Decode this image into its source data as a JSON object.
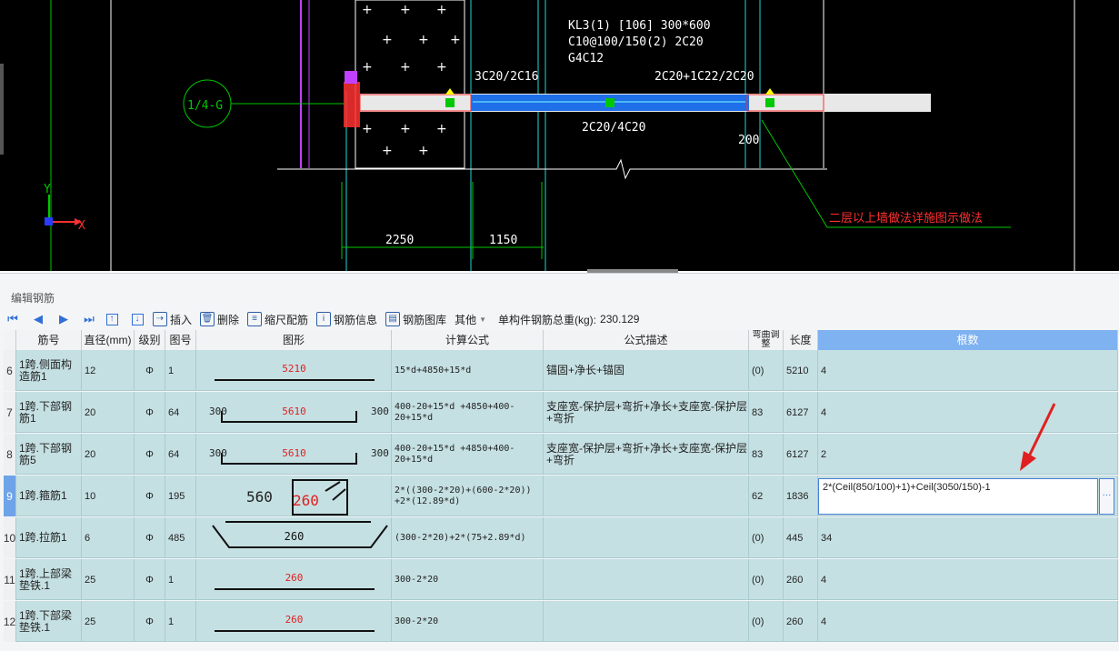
{
  "cad": {
    "beam_label": "KL3(1) [106] 300*600",
    "stirrup_label": "C10@100/150(2) 2C20",
    "side_bar_label": "G4C12",
    "left_top_bar": "3C20/2C16",
    "right_top_bar": "2C20+1C22/2C20",
    "bottom_bar": "2C20/4C20",
    "dim_2250": "2250",
    "dim_1150": "1150",
    "dim_200": "200",
    "axis_label": "1/4-G",
    "axis_y": "Y",
    "axis_x": "X",
    "note": "二层以上墙做法详施图示做法",
    "colors": {
      "beam": "#1e6fe8",
      "green": "#00c800",
      "magenta": "#c040ff",
      "red": "#ff3030",
      "cyan": "#1fd6d6"
    }
  },
  "panel": {
    "title": "编辑钢筋",
    "toolbar": {
      "nav_first": "first-icon",
      "nav_prev": "prev-icon",
      "nav_next": "next-icon",
      "nav_last": "last-icon",
      "move_up": "move-up-icon",
      "move_down": "move-down-icon",
      "insert": "插入",
      "delete": "删除",
      "scale": "缩尺配筋",
      "info": "钢筋信息",
      "library": "钢筋图库",
      "other": "其他",
      "weight_label": "单构件钢筋总重(kg):",
      "weight_value": "230.129"
    },
    "columns": [
      "筋号",
      "直径(mm)",
      "级别",
      "图号",
      "图形",
      "计算公式",
      "公式描述",
      "弯曲调整",
      "长度",
      "根数"
    ],
    "rows": [
      {
        "idx": "6",
        "name": "1跨.侧面构造筋1",
        "dia": "12",
        "grade": "Φ",
        "fig": "1",
        "shape": {
          "type": "straight",
          "mid": "5210"
        },
        "formula": "15*d+4850+15*d",
        "desc": "锚固+净长+锚固",
        "bend": "(0)",
        "len": "5210",
        "count": "4"
      },
      {
        "idx": "7",
        "name": "1跨.下部钢筋1",
        "dia": "20",
        "grade": "Φ",
        "fig": "64",
        "shape": {
          "type": "u",
          "left": "300",
          "mid": "5610",
          "right": "300"
        },
        "formula": "400-20+15*d +4850+400-20+15*d",
        "desc": "支座宽-保护层+弯折+净长+支座宽-保护层+弯折",
        "bend": "83",
        "len": "6127",
        "count": "4"
      },
      {
        "idx": "8",
        "name": "1跨.下部钢筋5",
        "dia": "20",
        "grade": "Φ",
        "fig": "64",
        "shape": {
          "type": "u",
          "left": "300",
          "mid": "5610",
          "right": "300"
        },
        "formula": "400-20+15*d +4850+400-20+15*d",
        "desc": "支座宽-保护层+弯折+净长+支座宽-保护层+弯折",
        "bend": "83",
        "len": "6127",
        "count": "2"
      },
      {
        "idx": "9",
        "name": "1跨.箍筋1",
        "dia": "10",
        "grade": "Φ",
        "fig": "195",
        "shape": {
          "type": "stirrup",
          "left": "560",
          "mid": "260"
        },
        "formula": "2*((300-2*20)+(600-2*20)) +2*(12.89*d)",
        "desc": "",
        "bend": "62",
        "len": "1836",
        "count": "2*(Ceil(850/100)+1)+Ceil(3050/150)-1",
        "editing": true
      },
      {
        "idx": "10",
        "name": "1跨.拉筋1",
        "dia": "6",
        "grade": "Φ",
        "fig": "485",
        "shape": {
          "type": "tie",
          "mid": "260"
        },
        "formula": "(300-2*20)+2*(75+2.89*d)",
        "desc": "",
        "bend": "(0)",
        "len": "445",
        "count": "34"
      },
      {
        "idx": "11",
        "name": "1跨.上部梁垫铁.1",
        "dia": "25",
        "grade": "Φ",
        "fig": "1",
        "shape": {
          "type": "straight",
          "mid": "260"
        },
        "formula": "300-2*20",
        "desc": "",
        "bend": "(0)",
        "len": "260",
        "count": "4"
      },
      {
        "idx": "12",
        "name": "1跨.下部梁垫铁.1",
        "dia": "25",
        "grade": "Φ",
        "fig": "1",
        "shape": {
          "type": "straight",
          "mid": "260"
        },
        "formula": "300-2*20",
        "desc": "",
        "bend": "(0)",
        "len": "260",
        "count": "4"
      }
    ]
  }
}
